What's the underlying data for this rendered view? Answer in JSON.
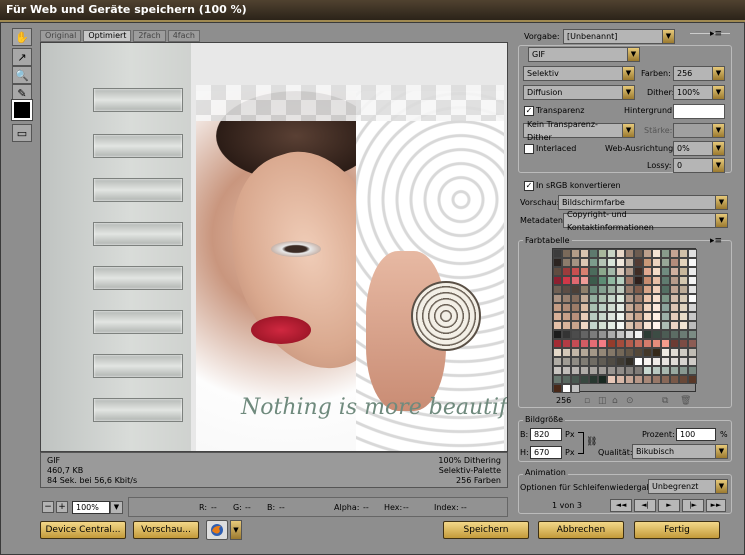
{
  "window": {
    "title": "Für Web und Geräte speichern (100 %)"
  },
  "tabs": [
    {
      "label": "Original"
    },
    {
      "label": "Optimiert"
    },
    {
      "label": "2fach"
    },
    {
      "label": "4fach"
    }
  ],
  "preview": {
    "tagline": "Nothing is more beautiful"
  },
  "info": {
    "format": "GIF",
    "size": "460,7 KB",
    "time": "84 Sek. bei 56,6 Kbit/s",
    "dither": "100% Dithering",
    "palette": "Selektiv-Palette",
    "colors": "256 Farben"
  },
  "status": {
    "zoom": "100%",
    "r_label": "R:",
    "r_value": "--",
    "g_label": "G:",
    "g_value": "--",
    "b_label": "B:",
    "b_value": "--",
    "alpha_label": "Alpha:",
    "alpha_value": "--",
    "hex_label": "Hex:",
    "hex_value": "--",
    "index_label": "Index:",
    "index_value": "--"
  },
  "settings": {
    "preset_label": "Vorgabe:",
    "preset_value": "[Unbenannt]",
    "format": "GIF",
    "reduction": "Selektiv",
    "colors_label": "Farben:",
    "colors_value": "256",
    "dither_algo": "Diffusion",
    "dither_label": "Dither:",
    "dither_value": "100%",
    "transparency": "Transparenz",
    "matte_label": "Hintergrund:",
    "transp_dither": "Kein Transparenz-Dither",
    "amount_label": "Stärke:",
    "interlaced": "Interlaced",
    "websnap_label": "Web-Ausrichtung:",
    "websnap_value": "0%",
    "lossy_label": "Lossy:",
    "lossy_value": "0",
    "srgb": "In sRGB konvertieren",
    "preview_label": "Vorschau:",
    "preview_value": "Bildschirmfarbe",
    "metadata_label": "Metadaten:",
    "metadata_value": "Copyright- und Kontaktinformationen"
  },
  "color_table": {
    "title": "Farbtabelle",
    "count": "256",
    "colors": [
      "#3c3c3c",
      "#7a6a5a",
      "#b29c88",
      "#d8c4b0",
      "#5e7a6e",
      "#a8b89c",
      "#c8d4c4",
      "#e8d8c8",
      "#9c8474",
      "#6c5c50",
      "#bca08c",
      "#f4e4d4",
      "#889c8c",
      "#c4a494",
      "#d0c0a8",
      "#e0e0e0",
      "#2c2420",
      "#8c7c6c",
      "#a49484",
      "#dcc8b4",
      "#7c9c8c",
      "#b4c4b4",
      "#d8e4d8",
      "#f0e8dc",
      "#c4b4a4",
      "#543c34",
      "#c89878",
      "#ecd4c0",
      "#98a898",
      "#b48c7c",
      "#e4d4bc",
      "#f8f8f8",
      "#604c40",
      "#9c3c3c",
      "#c85050",
      "#d88070",
      "#4c6c5c",
      "#8ca88c",
      "#a4b8a8",
      "#dccabc",
      "#b09888",
      "#402c24",
      "#e0a890",
      "#f4dcc8",
      "#708c80",
      "#d0b0a0",
      "#c8b89c",
      "#ececec",
      "#8c2030",
      "#d03848",
      "#e06870",
      "#f09c98",
      "#3c5c4c",
      "#5c8c74",
      "#90b8a0",
      "#b8d0c0",
      "#a07868",
      "#30201c",
      "#c88c70",
      "#e8c0a8",
      "#607c70",
      "#b89c8c",
      "#d4c8b0",
      "#f4f4f4",
      "#706054",
      "#5c4c44",
      "#4c4038",
      "#90806c",
      "#6c8c7c",
      "#84a090",
      "#a0b4a4",
      "#c0ccc0",
      "#987c6c",
      "#805c4c",
      "#d8a488",
      "#f0d0bc",
      "#547064",
      "#c0a494",
      "#bcac98",
      "#e4e4e4",
      "#ac9484",
      "#988070",
      "#846c5c",
      "#c4ac98",
      "#94b0a0",
      "#acc0b0",
      "#c4d4c8",
      "#dce8dc",
      "#b49c8c",
      "#a08070",
      "#ecc4ac",
      "#f8e0d0",
      "#7c9888",
      "#d4bcac",
      "#d8ccb8",
      "#fcfcfc",
      "#c49c84",
      "#b08c78",
      "#9c7c68",
      "#dcbca4",
      "#a8c0b0",
      "#bcd0c4",
      "#d0dcd0",
      "#e4ece4",
      "#c8ac98",
      "#b89480",
      "#f0d4c0",
      "#fce8dc",
      "#8ca49c",
      "#dcc4b4",
      "#e0d4c0",
      "#d4d4d4",
      "#d8b098",
      "#c8a088",
      "#b8907c",
      "#e8ccb8",
      "#b8ccc0",
      "#c8d8cc",
      "#dce4dc",
      "#eef4ee",
      "#d4b8a4",
      "#c8a48c",
      "#f4dcc8",
      "#fff0e4",
      "#9cb0a8",
      "#e4ccbc",
      "#e8dcc8",
      "#c8c8c8",
      "#e4c0a8",
      "#d8b49c",
      "#c8a48c",
      "#f0d8c4",
      "#c4d4cc",
      "#d4e0d4",
      "#e4ece4",
      "#f4f8f4",
      "#dcc4b0",
      "#d4b09c",
      "#f8e4d4",
      "#fff4ec",
      "#acbcb4",
      "#ecd4c4",
      "#f0e4d4",
      "#bcbcbc",
      "#1c1c1c",
      "#343434",
      "#4c4c4c",
      "#646464",
      "#7c7c7c",
      "#949494",
      "#acacac",
      "#c4c4c4",
      "#dcdcdc",
      "#f4f4f4",
      "#2c3c34",
      "#3c4c44",
      "#4c5c54",
      "#5c6c64",
      "#6c7c74",
      "#7c8c84",
      "#a42c34",
      "#b43c44",
      "#c44c54",
      "#d45c64",
      "#e46c74",
      "#f47c84",
      "#943c2c",
      "#a44c3c",
      "#b45c4c",
      "#c46c5c",
      "#d47c6c",
      "#e48c7c",
      "#f49c8c",
      "#6c3c34",
      "#7c4c44",
      "#8c5c54",
      "#e4d8c8",
      "#d4c8b8",
      "#c4b8a8",
      "#b4a898",
      "#a49888",
      "#948878",
      "#847868",
      "#746858",
      "#645848",
      "#544838",
      "#443828",
      "#342818",
      "#f0ece4",
      "#e0dcd4",
      "#d0ccc4",
      "#c0bcb4",
      "#b0aca4",
      "#a09c94",
      "#908c84",
      "#807c74",
      "#706c64",
      "#605c54",
      "#504c44",
      "#403c34",
      "#302c24",
      "#ffffff",
      "#f8f4f0",
      "#f0ece8",
      "#e8e4e0",
      "#e0dcd8",
      "#d8d4d0",
      "#d0ccc8",
      "#c8c4c0",
      "#c0bcb8",
      "#b8b4b0",
      "#b0aca8",
      "#a8a4a0",
      "#a09c98",
      "#989490",
      "#908c88",
      "#888480",
      "#807c78",
      "#c8d8d0",
      "#b8c8c0",
      "#a8b8b0",
      "#98a8a0",
      "#889890",
      "#788880",
      "#687870",
      "#586860",
      "#485850",
      "#384840",
      "#283830",
      "#182820",
      "#e8c8b8",
      "#d8b8a8",
      "#c8a898",
      "#b89888",
      "#a88878",
      "#987868",
      "#886858",
      "#785848",
      "#684838",
      "#583828",
      "#482818",
      "#ffffff",
      "#c0c0c0"
    ]
  },
  "image_size": {
    "title": "Bildgröße",
    "w_label": "B:",
    "w_value": "820",
    "w_unit": "Px",
    "h_label": "H:",
    "h_value": "670",
    "h_unit": "Px",
    "percent_label": "Prozent:",
    "percent_value": "100",
    "percent_unit": "%",
    "quality_label": "Qualität:",
    "quality_value": "Bikubisch"
  },
  "animation": {
    "title": "Animation",
    "loop_label": "Optionen für Schleifenwiedergabe:",
    "loop_value": "Unbegrenzt",
    "frame": "1 von 3",
    "nav": [
      "◄◄",
      "◄|",
      "►",
      "|►",
      "►►"
    ]
  },
  "buttons": {
    "device_central": "Device Central...",
    "preview": "Vorschau...",
    "save": "Speichern",
    "cancel": "Abbrechen",
    "done": "Fertig"
  }
}
